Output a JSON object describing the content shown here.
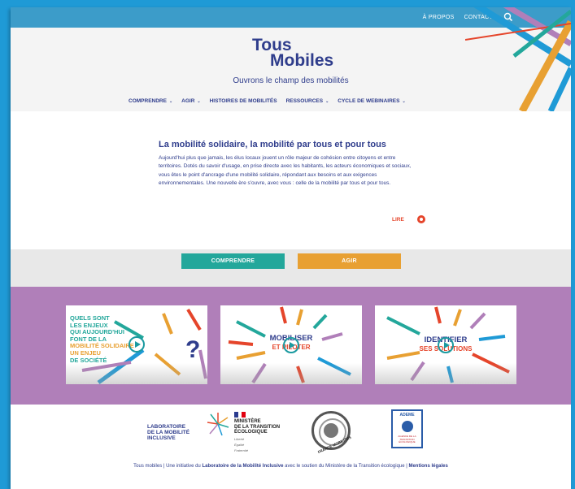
{
  "topbar": {
    "links": [
      "À PROPOS",
      "CONTACT"
    ],
    "search_icon": "search-icon"
  },
  "header": {
    "logo_line1": "Tous",
    "logo_line2": "Mobiles",
    "tagline": "Ouvrons le champ des mobilités",
    "nav": [
      "COMPRENDRE",
      "AGIR",
      "HISTOIRES DE MOBILITÉS",
      "RESSOURCES",
      "CYCLE DE WEBINAIRES"
    ],
    "nav_has_dropdown": [
      true,
      true,
      false,
      true,
      true
    ]
  },
  "intro": {
    "title": "La mobilité solidaire, la mobilité par tous et pour tous",
    "body": "Aujourd'hui plus que jamais, les élus locaux jouent un rôle majeur de cohésion entre citoyens et entre territoires. Dotés du savoir d'usage, en prise directe avec les habitants, les acteurs économiques et sociaux, vous êtes le point d'ancrage d'une mobilité solidaire, répondant aux besoins et aux exigences environnementales. Une nouvelle ère s'ouvre, avec vous : celle de la mobilité par tous et pour tous.",
    "read_more": "LIRE"
  },
  "buttons": {
    "comprendre": "COMPRENDRE",
    "agir": "AGIR"
  },
  "cards": {
    "card1": {
      "lines": [
        "QUELS SONT",
        "LES ENJEUX",
        "QUI AUJOURD'HUI",
        "FONT DE LA",
        "MOBILITÉ SOLIDAIRE",
        "UN ENJEU",
        "DE SOCIÉTÉ"
      ],
      "mark": "?"
    },
    "card2": {
      "title1": "MOBILISER",
      "title2": "ET PILOTER"
    },
    "card3": {
      "title1": "IDENTIFIER",
      "title2": "SES SOLUTIONS"
    }
  },
  "footer": {
    "lab_logo": [
      "LABORATOIRE",
      "DE LA MOBILITÉ",
      "INCLUSIVE"
    ],
    "ministry_logo": [
      "MINISTÈRE",
      "DE LA TRANSITION",
      "ÉCOLOGIQUE"
    ],
    "ministry_motto": [
      "Liberté",
      "Égalité",
      "Fraternité"
    ],
    "fm_logo": "FRANCE MOBILITÉS",
    "ademe_logo": "ADEME",
    "ademe_sub": "AGENCE DE LA TRANSITION ÉCOLOGIQUE",
    "line_part1": "Tous mobiles | Une initiative du ",
    "line_part2": "Laboratoire de la Mobilité Inclusive",
    "line_part3": " avec le soutien du Ministère de la Transition écologique | ",
    "line_part4": "Mentions légales"
  },
  "colors": {
    "navy": "#2f3d8c",
    "teal": "#23a79b",
    "orange": "#e8a032",
    "red": "#e5452b",
    "purple": "#b07fb9",
    "blue": "#1f9ad6"
  }
}
